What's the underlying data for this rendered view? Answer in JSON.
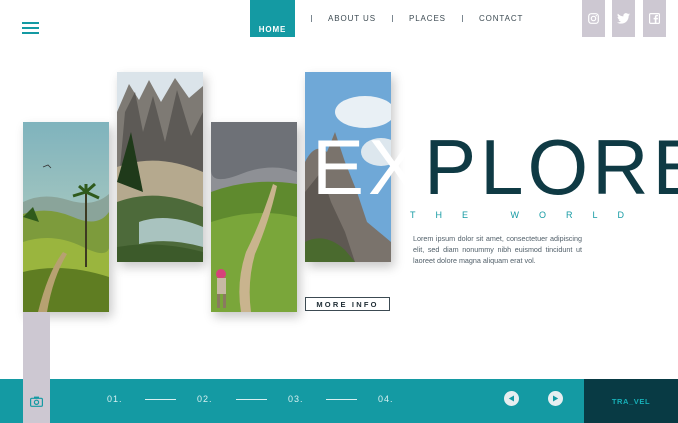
{
  "nav": {
    "items": [
      {
        "label": "HOME",
        "active": true
      },
      {
        "label": "ABOUT US"
      },
      {
        "label": "PLACES"
      },
      {
        "label": "CONTACT"
      }
    ]
  },
  "social": [
    "instagram-icon",
    "twitter-icon",
    "facebook-icon"
  ],
  "hero": {
    "title_light": "EX",
    "title_dark": "PLORE",
    "subtitle": "THE WORLD",
    "body": "Lorem ipsum dolor sit amet, consectetuer adipiscing elit, sed diam nonummy nibh euismod tincidunt ut laoreet dolore magna aliquam erat vol.",
    "button": "MORE INFO"
  },
  "footer": {
    "pages": [
      "01.",
      "02.",
      "03.",
      "04."
    ],
    "brand": "TRA_VEL",
    "icons": {
      "camera": "camera-icon",
      "prev": "prev-arrow-icon",
      "next": "next-arrow-icon"
    }
  },
  "colors": {
    "accent": "#149aa3",
    "dark": "#0f3a44",
    "brand_bg": "#083a44",
    "panel": "#cdc8d2"
  }
}
